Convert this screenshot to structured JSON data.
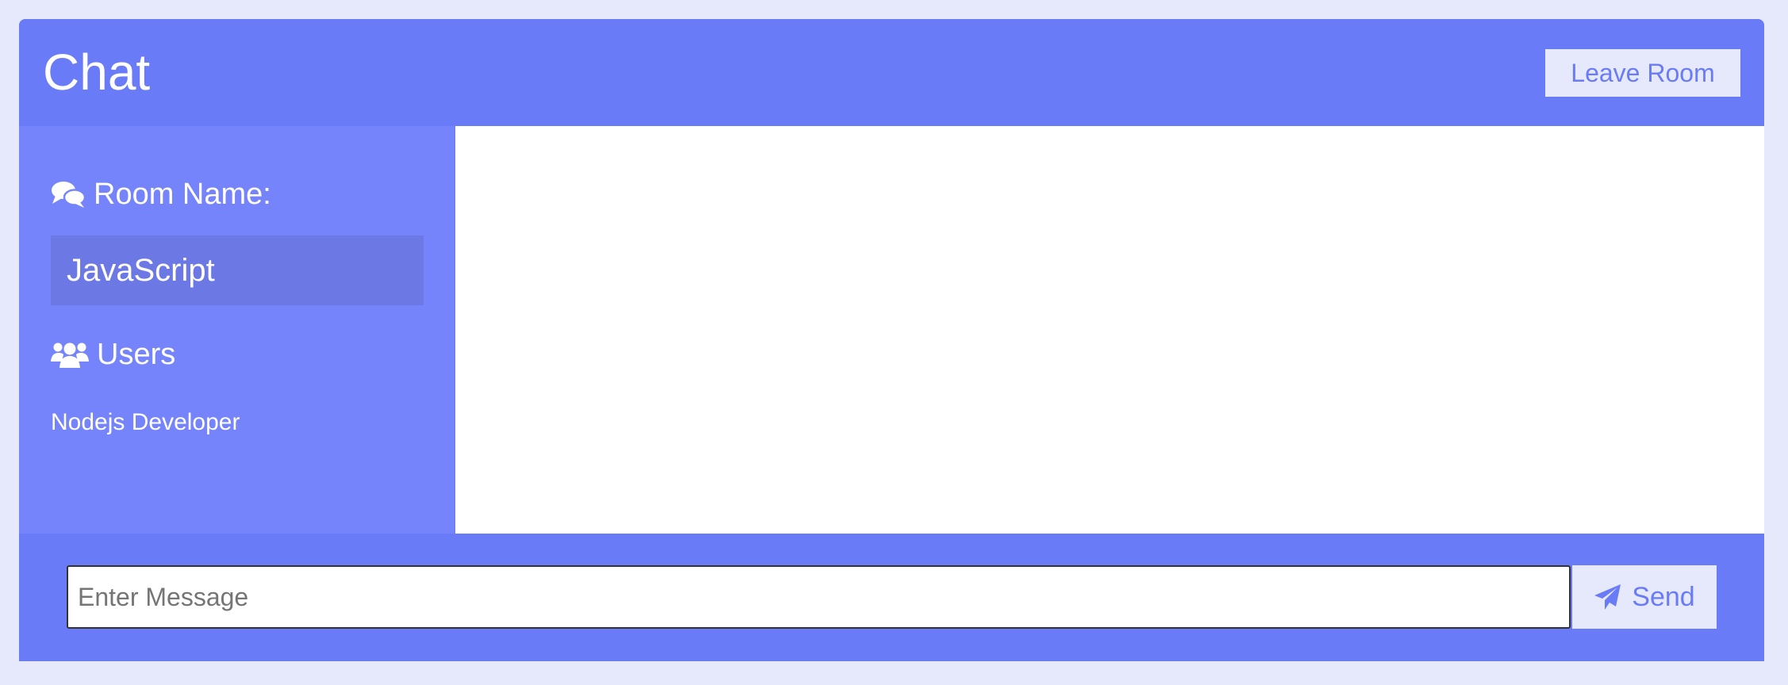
{
  "header": {
    "title": "Chat",
    "leave_label": "Leave Room"
  },
  "sidebar": {
    "room_heading": "Room Name:",
    "room_icon": "comments-icon",
    "room_name": "JavaScript",
    "users_heading": "Users",
    "users_icon": "users-icon",
    "users": [
      "Nodejs Developer"
    ]
  },
  "footer": {
    "input_placeholder": "Enter Message",
    "input_value": "",
    "send_label": "Send",
    "send_icon": "paper-plane-icon"
  },
  "colors": {
    "page_background": "#e6e9fb",
    "primary": "#6a7bf8",
    "sidebar": "#7584fa",
    "room_box": "#6c78e3",
    "text_light": "#ffffff"
  }
}
